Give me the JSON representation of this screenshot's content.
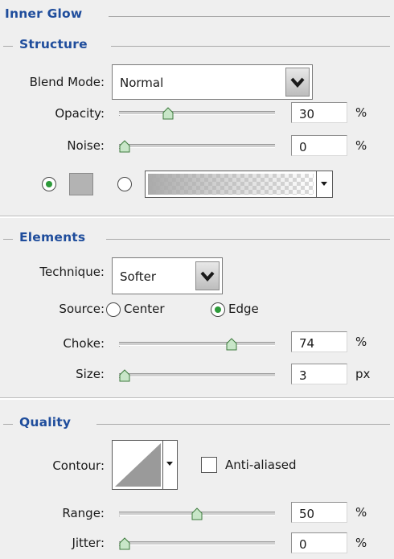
{
  "panel": {
    "title": "Inner Glow",
    "colors": {
      "heading": "#1f4d9c",
      "background": "#efefef",
      "radio_dot": "#2d9a3a",
      "swatch": "#b3b3b3"
    }
  },
  "structure": {
    "heading": "Structure",
    "blend_mode": {
      "label": "Blend Mode:",
      "value": "Normal"
    },
    "opacity": {
      "label": "Opacity:",
      "value": "30",
      "unit": "%",
      "slider_fraction": 0.3
    },
    "noise": {
      "label": "Noise:",
      "value": "0",
      "unit": "%",
      "slider_fraction": 0.0
    },
    "fill": {
      "color_option_selected": true,
      "gradient_option_selected": false
    }
  },
  "elements": {
    "heading": "Elements",
    "technique": {
      "label": "Technique:",
      "value": "Softer"
    },
    "source": {
      "label": "Source:",
      "options": [
        {
          "label": "Center",
          "selected": false
        },
        {
          "label": "Edge",
          "selected": true
        }
      ]
    },
    "choke": {
      "label": "Choke:",
      "value": "74",
      "unit": "%",
      "slider_fraction": 0.74
    },
    "size": {
      "label": "Size:",
      "value": "3",
      "unit": "px",
      "slider_fraction": 0.0
    }
  },
  "quality": {
    "heading": "Quality",
    "contour": {
      "label": "Contour:"
    },
    "anti_aliased": {
      "label": "Anti-aliased",
      "checked": false
    },
    "range": {
      "label": "Range:",
      "value": "50",
      "unit": "%",
      "slider_fraction": 0.5
    },
    "jitter": {
      "label": "Jitter:",
      "value": "0",
      "unit": "%",
      "slider_fraction": 0.0
    }
  },
  "icons": {
    "dropdown_arrow": "chevron-down-icon",
    "small_dropdown_arrow": "caret-down-icon",
    "slider_thumb": "slider-thumb-icon"
  }
}
